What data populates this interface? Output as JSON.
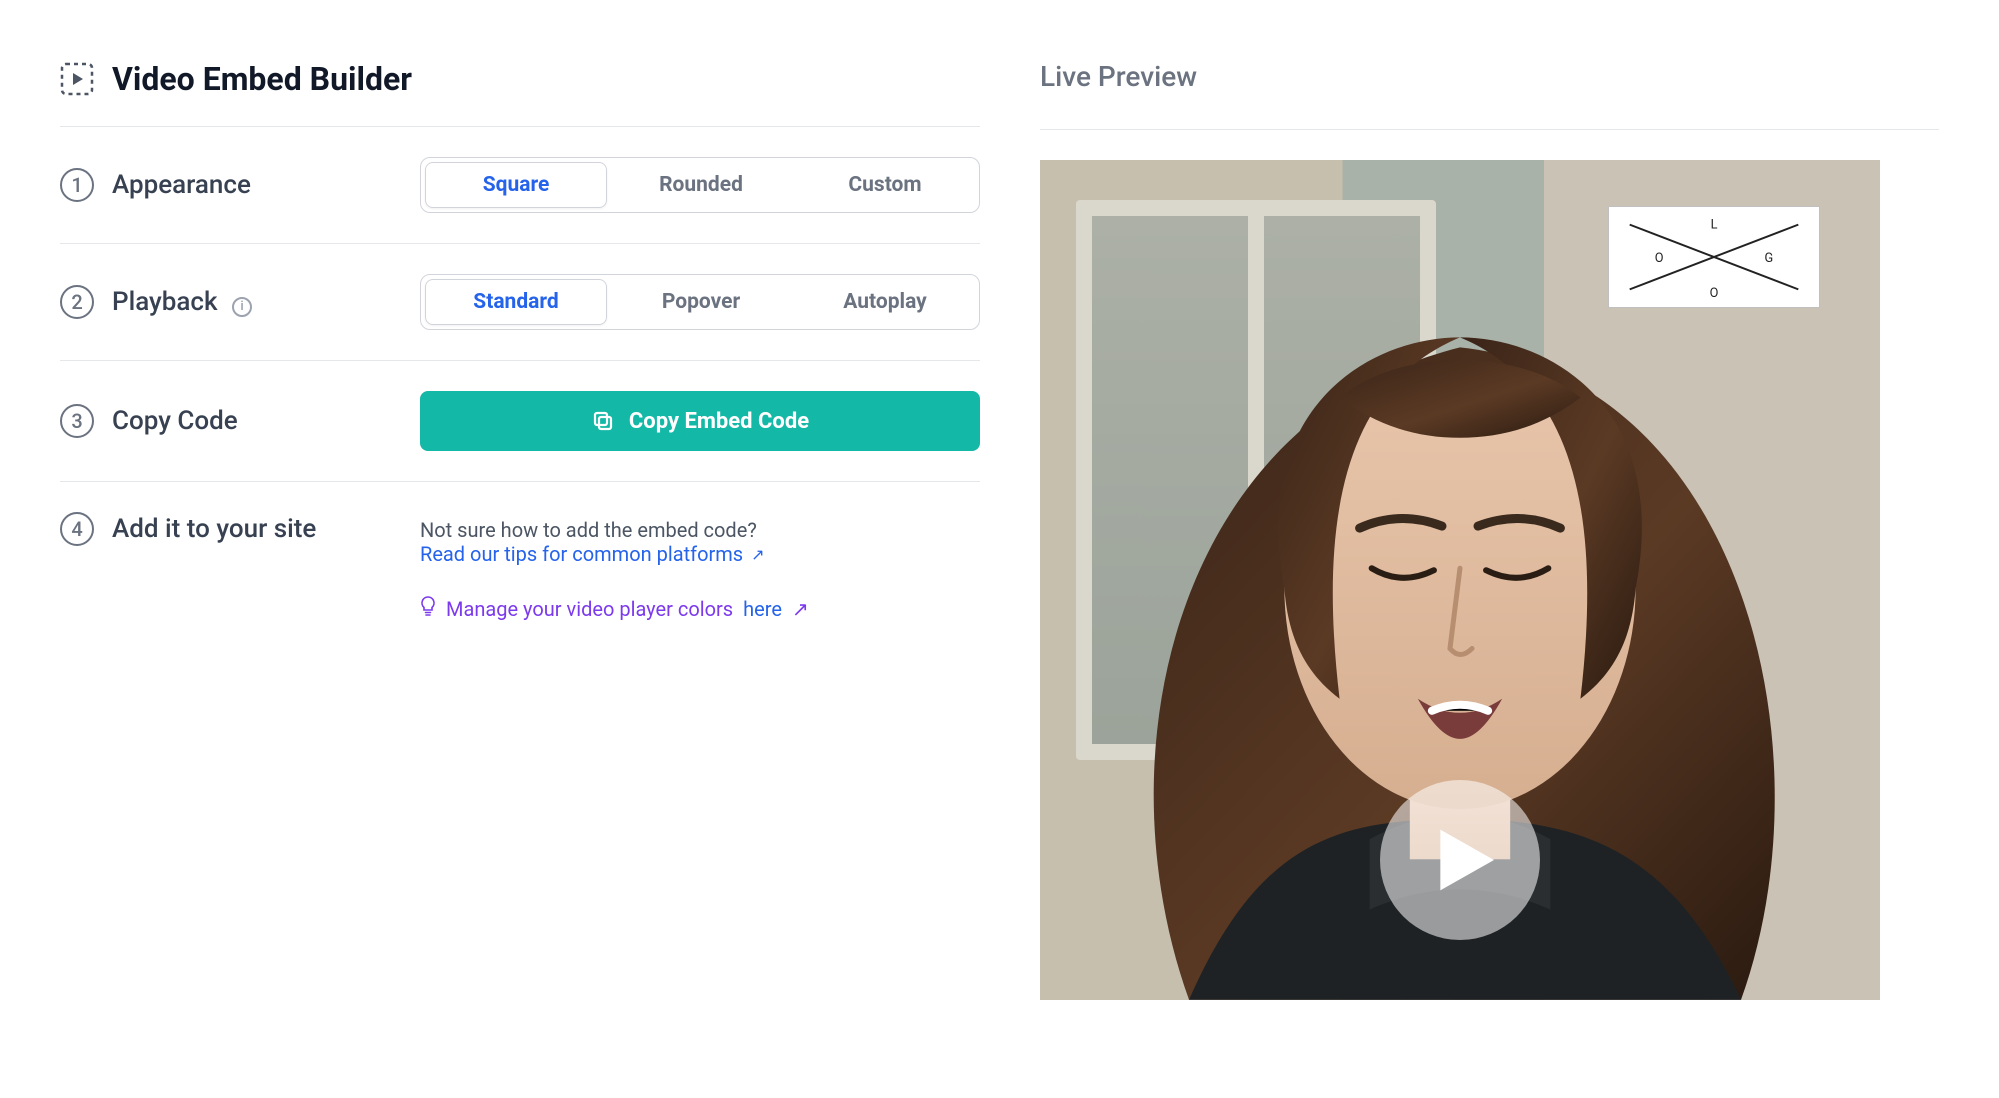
{
  "header": {
    "title": "Video Embed Builder"
  },
  "steps": {
    "appearance": {
      "num": "1",
      "title": "Appearance",
      "options": {
        "square": "Square",
        "rounded": "Rounded",
        "custom": "Custom"
      }
    },
    "playback": {
      "num": "2",
      "title": "Playback",
      "options": {
        "standard": "Standard",
        "popover": "Popover",
        "autoplay": "Autoplay"
      }
    },
    "copy": {
      "num": "3",
      "title": "Copy Code",
      "button": "Copy Embed Code"
    },
    "add": {
      "num": "4",
      "title": "Add it to your site",
      "note1": "Not sure how to add the embed code?",
      "link1": "Read our tips for common platforms",
      "note2": "Manage your video player colors",
      "note2_here": "here"
    }
  },
  "preview": {
    "title": "Live Preview",
    "logo_letters": {
      "l": "L",
      "o1": "O",
      "g": "G",
      "o2": "O"
    }
  },
  "icons": {
    "info": "i",
    "external_arrow": "↗"
  }
}
